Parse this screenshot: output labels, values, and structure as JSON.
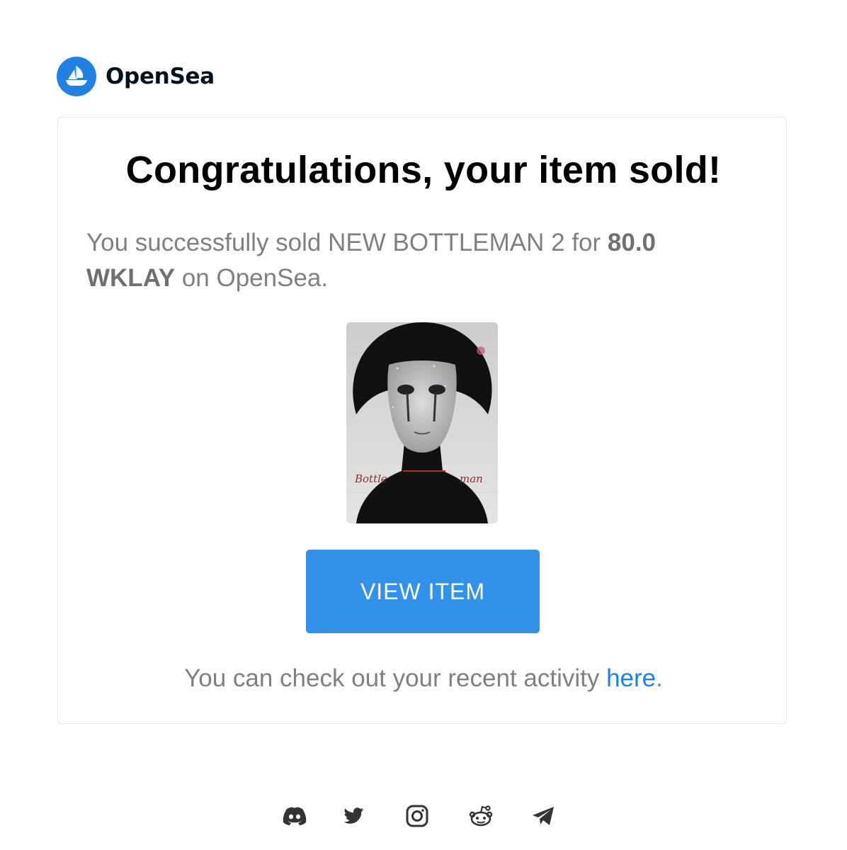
{
  "brand": {
    "name": "OpenSea",
    "accent_color": "#2081e2"
  },
  "email": {
    "title": "Congratulations, your item sold!",
    "message_prefix": "You successfully sold NEW BOTTLEMAN 2 for ",
    "price": "80.0 WKLAY",
    "message_suffix": " on OpenSea.",
    "item_image_lettering": "Bottle man",
    "button_label": "VIEW ITEM",
    "button_color": "#3291e9",
    "activity_prefix": "You can check out your recent activity ",
    "activity_link": "here",
    "activity_suffix": "."
  },
  "socials": [
    {
      "icon": "discord-icon"
    },
    {
      "icon": "twitter-icon"
    },
    {
      "icon": "instagram-icon"
    },
    {
      "icon": "reddit-icon"
    },
    {
      "icon": "telegram-icon"
    }
  ]
}
